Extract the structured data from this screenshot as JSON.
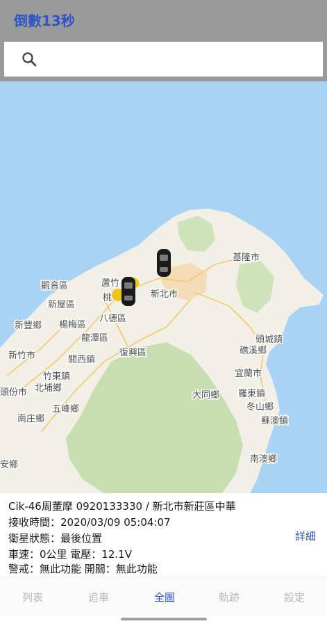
{
  "header": {
    "title": "倒數13秒"
  },
  "search": {
    "placeholder": ""
  },
  "map": {
    "labels": {
      "keelung": "基隆市",
      "newtaipei": "新北市",
      "guanyin": "觀音區",
      "luzhu": "蘆竹",
      "taoyuan": "桃",
      "xinwu": "新屋區",
      "bade": "八德區",
      "yangmei": "楊梅區",
      "longtan": "龍潭區",
      "xinfeng": "新豐鄉",
      "guanxi": "關西鎮",
      "fuxing": "復興區",
      "toucheng": "頭城鎮",
      "jiaoxi": "礁溪鄉",
      "hsinchu": "新竹市",
      "zhudong": "竹東鎮",
      "beipu": "北埔鄉",
      "yilan": "宜蘭市",
      "datong": "大同鄉",
      "luodong": "羅東鎮",
      "dongshan": "冬山鄉",
      "suao": "蘇澳鎮",
      "toufen": "頭份市",
      "wufeng": "五峰鄉",
      "nanzhuang": "南庄鄉",
      "nanao": "南澳鄉",
      "zaoqiao": "安鄉"
    },
    "vehicle_count_markers": 2
  },
  "info": {
    "line1": "Cik-46周董摩 0920133330 / 新北市新莊區中華",
    "line2": "接收時間：2020/03/09 05:04:07",
    "line3": "衛星狀態：最後位置",
    "line4": "車速：0公里 電壓：12.1V",
    "line5": "警戒：無此功能  開關：無此功能",
    "detail_label": "詳細"
  },
  "nav": {
    "list": "列表",
    "track": "追車",
    "overview": "全圖",
    "trail": "軌跡",
    "settings": "設定",
    "active": "overview"
  },
  "colors": {
    "accent": "#2d55c9",
    "header_bg": "#9a9a9a",
    "sea": "#a9d3f4",
    "land": "#f1efe6",
    "forest": "#c7dfb0"
  }
}
